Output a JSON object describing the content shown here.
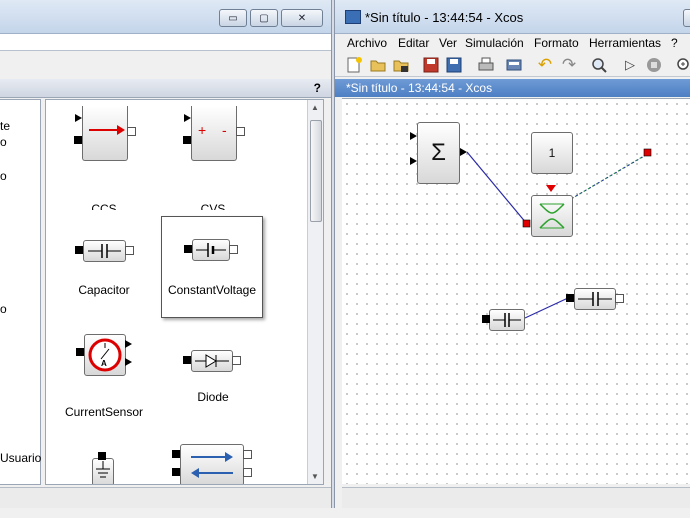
{
  "left_window": {
    "minimize_glyph": "▭",
    "maximize_glyph": "▢",
    "close_glyph": "✕",
    "help_label": "?",
    "tree_items": [
      "te",
      "o",
      "o",
      "o",
      "Usuario"
    ],
    "palette": {
      "blocks": [
        {
          "label": "CCS",
          "icon": "current-source-arrow-icon"
        },
        {
          "label": "CVS",
          "icon": "voltage-source-plus-minus-icon"
        },
        {
          "label": "Capacitor",
          "icon": "capacitor-icon"
        },
        {
          "label": "ConstantVoltage",
          "icon": "battery-icon"
        },
        {
          "label": "CurrentSensor",
          "icon": "ammeter-icon"
        },
        {
          "label": "Diode",
          "icon": "diode-icon"
        },
        {
          "label": "",
          "icon": "ground-icon"
        },
        {
          "label": "",
          "icon": "bidirectional-arrows-icon"
        }
      ]
    }
  },
  "right_window": {
    "title": "*Sin título - 13:44:54 - Xcos",
    "minimize_glyph": "—",
    "menu": [
      "Archivo",
      "Editar",
      "Ver",
      "Simulación",
      "Formato",
      "Herramientas",
      "?"
    ],
    "toolbar_icons": [
      "new-icon",
      "open-icon",
      "open-in-icon",
      "save-icon",
      "save-as-icon",
      "print-icon",
      "export-icon",
      "undo-icon",
      "redo-icon",
      "zoom-fit-icon",
      "start-icon",
      "stop-icon",
      "zoom-in-icon"
    ],
    "tab_title": "*Sin título - 13:44:54 - Xcos",
    "diagram": {
      "sum_symbol": "Σ",
      "const_value": "1"
    }
  },
  "colors": {
    "accent": "#4d7fc4",
    "link_blue": "#2a2aa8",
    "link_green": "#2e8b57",
    "port_red": "#e00000"
  }
}
